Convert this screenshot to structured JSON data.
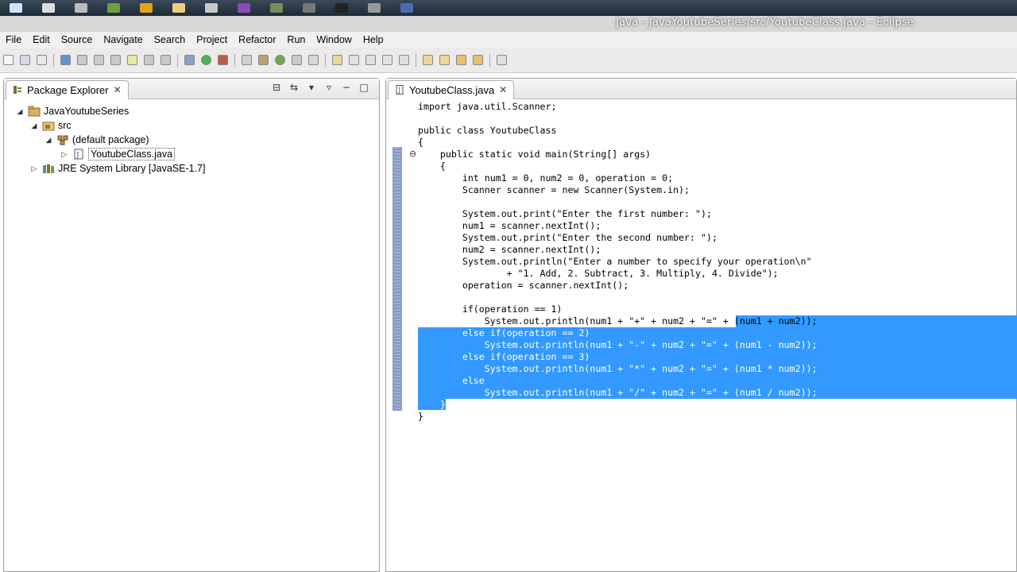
{
  "window": {
    "title": "Java - JavaYoutubeSeries/src/YoutubeClass.java - Eclipse"
  },
  "menubar": {
    "items": [
      "File",
      "Edit",
      "Source",
      "Navigate",
      "Search",
      "Project",
      "Refactor",
      "Run",
      "Window",
      "Help"
    ]
  },
  "package_explorer": {
    "tab_label": "Package Explorer",
    "tree": {
      "project": "JavaYoutubeSeries",
      "src": "src",
      "package": "(default package)",
      "file": "YoutubeClass.java",
      "library": "JRE System Library [JavaSE-1.7]"
    }
  },
  "editor": {
    "tab_label": "YoutubeClass.java",
    "lines": [
      "import java.util.Scanner;",
      "",
      "public class YoutubeClass",
      "{",
      "    public static void main(String[] args)",
      "    {",
      "        int num1 = 0, num2 = 0, operation = 0;",
      "        Scanner scanner = new Scanner(System.in);",
      "",
      "        System.out.print(\"Enter the first number: \");",
      "        num1 = scanner.nextInt();",
      "        System.out.print(\"Enter the second number: \");",
      "        num2 = scanner.nextInt();",
      "        System.out.println(\"Enter a number to specify your operation\\n\"",
      "                + \"1. Add, 2. Subtract, 3. Multiply, 4. Divide\");",
      "        operation = scanner.nextInt();",
      "",
      "        if(operation == 1)",
      "            System.out.println(num1 + \"+\" + num2 + \"=\" + (num1 + num2));",
      "        else if(operation == 2)",
      "            System.out.println(num1 + \"-\" + num2 + \"=\" + (num1 - num2));",
      "        else if(operation == 3)",
      "            System.out.println(num1 + \"*\" + num2 + \"=\" + (num1 * num2));",
      "        else",
      "            System.out.println(num1 + \"/\" + num2 + \"=\" + (num1 / num2));",
      "    }",
      "}"
    ]
  }
}
